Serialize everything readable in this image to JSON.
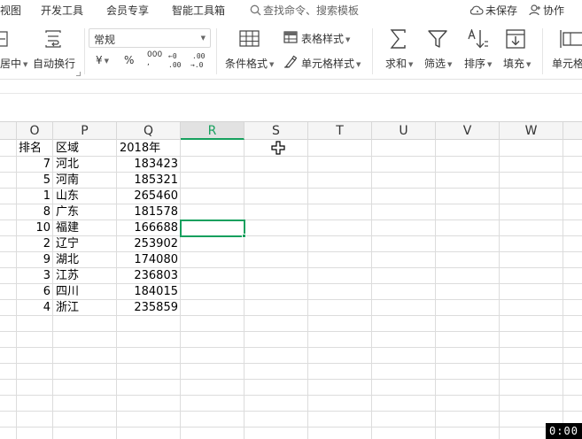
{
  "menubar": {
    "items": [
      "视图",
      "开发工具",
      "会员专享",
      "智能工具箱"
    ],
    "search_placeholder": "查找命令、搜索模板",
    "unsaved": "未保存",
    "collab": "协作"
  },
  "ribbon": {
    "merge_label": "居中",
    "wrap_label": "自动换行",
    "number_format": "常规",
    "currency": "¥",
    "percent": "%",
    "thousands": "000",
    "dec_inc": "←0\n.00",
    "dec_dec": ".00\n→.0",
    "cond_format": "条件格式",
    "table_style": "表格样式",
    "cell_style": "单元格样式",
    "sum": "求和",
    "filter": "筛选",
    "sort": "排序",
    "fill": "填充",
    "cell": "单元格"
  },
  "grid": {
    "columns": [
      "O",
      "P",
      "Q",
      "R",
      "S",
      "T",
      "U",
      "V",
      "W"
    ],
    "active_column": "R",
    "headers": {
      "rank": "排名",
      "region": "区域",
      "year": "2018年"
    },
    "rows": [
      {
        "rank": "7",
        "region": "河北",
        "value": "183423"
      },
      {
        "rank": "5",
        "region": "河南",
        "value": "185321"
      },
      {
        "rank": "1",
        "region": "山东",
        "value": "265460"
      },
      {
        "rank": "8",
        "region": "广东",
        "value": "181578"
      },
      {
        "rank": "10",
        "region": "福建",
        "value": "166688"
      },
      {
        "rank": "2",
        "region": "辽宁",
        "value": "253902"
      },
      {
        "rank": "9",
        "region": "湖北",
        "value": "174080"
      },
      {
        "rank": "3",
        "region": "江苏",
        "value": "236803"
      },
      {
        "rank": "6",
        "region": "四川",
        "value": "184015"
      },
      {
        "rank": "4",
        "region": "浙江",
        "value": "235859"
      }
    ]
  },
  "timer": "0:00",
  "colors": {
    "accent": "#17a05e"
  }
}
